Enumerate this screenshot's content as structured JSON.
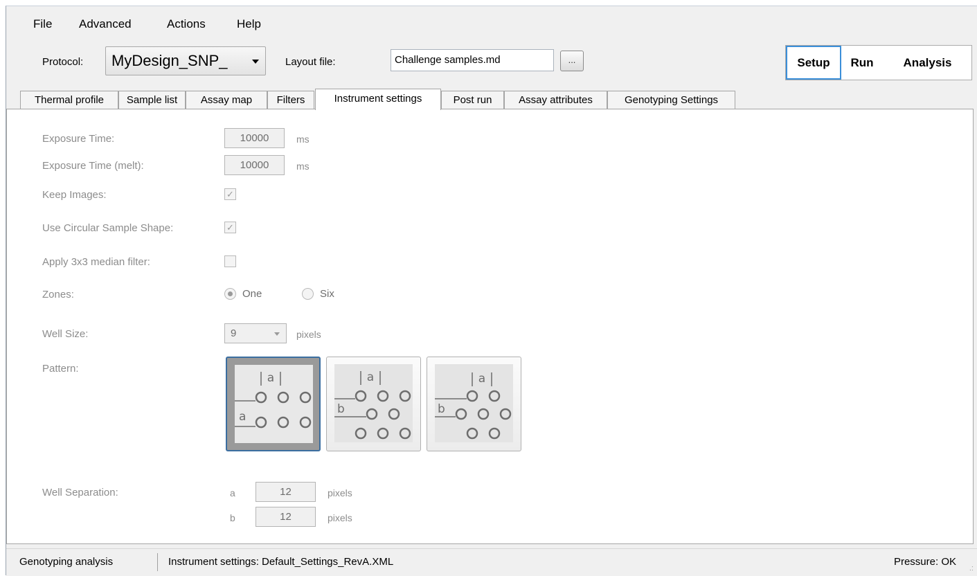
{
  "menu": {
    "items": [
      {
        "label": "File"
      },
      {
        "label": "Advanced"
      },
      {
        "label": "Actions"
      },
      {
        "label": "Help"
      }
    ]
  },
  "header": {
    "protocol_label": "Protocol:",
    "protocol_value": "MyDesign_SNP_",
    "layout_file_label": "Layout file:",
    "layout_file_value": "Challenge samples.md",
    "browse_label": "...",
    "modes": [
      {
        "label": "Setup",
        "active": true
      },
      {
        "label": "Run",
        "active": false
      },
      {
        "label": "Analysis",
        "active": false
      }
    ]
  },
  "tabs": [
    {
      "label": "Thermal profile"
    },
    {
      "label": "Sample list"
    },
    {
      "label": "Assay map"
    },
    {
      "label": "Filters"
    },
    {
      "label": "Instrument settings",
      "active": true
    },
    {
      "label": "Post run"
    },
    {
      "label": "Assay attributes"
    },
    {
      "label": "Genotyping Settings"
    }
  ],
  "settings": {
    "exposure_time": {
      "label": "Exposure Time:",
      "value": "10000",
      "unit": "ms"
    },
    "exposure_time_melt": {
      "label": "Exposure Time (melt):",
      "value": "10000",
      "unit": "ms"
    },
    "keep_images": {
      "label": "Keep Images:",
      "checked": true
    },
    "circular_shape": {
      "label": "Use Circular Sample Shape:",
      "checked": true
    },
    "median_filter": {
      "label": "Apply 3x3 median filter:",
      "checked": false
    },
    "zones": {
      "label": "Zones:",
      "options": [
        "One",
        "Six"
      ],
      "selected": "One"
    },
    "well_size": {
      "label": "Well Size:",
      "value": "9",
      "unit": "pixels"
    },
    "pattern": {
      "label": "Pattern:",
      "selected_index": 0,
      "glyph_a": "a",
      "glyph_b": "b"
    },
    "well_separation": {
      "label": "Well Separation:",
      "a": {
        "name": "a",
        "value": "12",
        "unit": "pixels"
      },
      "b": {
        "name": "b",
        "value": "12",
        "unit": "pixels"
      }
    }
  },
  "status": {
    "mode": "Genotyping analysis",
    "instrument_settings": "Instrument settings: Default_Settings_RevA.XML",
    "pressure": "Pressure: OK"
  },
  "colors": {
    "accent": "#3b8fd9",
    "disabled_text": "#8c8c8c"
  }
}
